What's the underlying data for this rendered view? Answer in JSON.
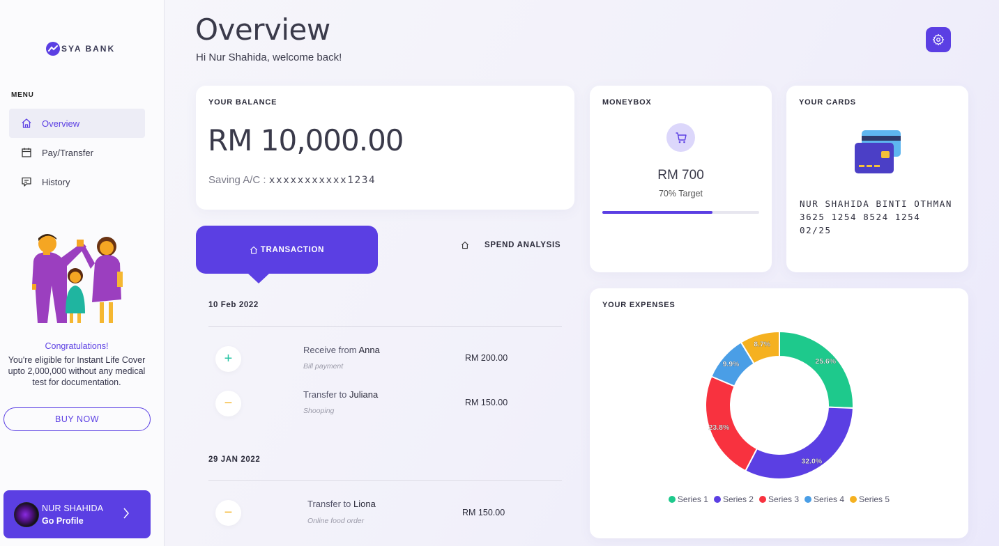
{
  "brand": {
    "name": "SYA BANK"
  },
  "sidebar": {
    "menu_title": "MENU",
    "items": [
      {
        "label": "Overview",
        "icon": "home-icon",
        "active": true
      },
      {
        "label": "Pay/Transfer",
        "icon": "calendar-icon",
        "active": false
      },
      {
        "label": "History",
        "icon": "message-icon",
        "active": false
      }
    ],
    "promo": {
      "title": "Congratulations!",
      "text": "You're eligible for Instant Life Cover upto 2,000,000 without any medical test for documentation.",
      "button": "BUY NOW"
    },
    "profile": {
      "name": "NUR SHAHIDA",
      "link": "Go Profile"
    }
  },
  "header": {
    "title": "Overview",
    "welcome": "Hi Nur Shahida, welcome back!"
  },
  "balance": {
    "label": "YOUR BALANCE",
    "amount": "RM 10,000.00",
    "account_prefix": "Saving A/C : ",
    "account_number": "xxxxxxxxxxx1234"
  },
  "moneybox": {
    "label": "MONEYBOX",
    "amount": "RM 700",
    "target": "70% Target",
    "progress": 0.7
  },
  "cards": {
    "label": "YOUR CARDS",
    "holder": "NUR SHAHIDA BINTI OTHMAN",
    "number": "3625 1254 8524 1254",
    "expiry": "02/25"
  },
  "tabs": {
    "active": "TRANSACTION",
    "inactive": "SPEND ANALYSIS"
  },
  "transactions": {
    "groups": [
      {
        "date": "10 Feb 2022",
        "items": [
          {
            "prefix": "Receive from ",
            "name": "Anna",
            "category": "Bill payment",
            "amount": "RM 200.00",
            "type": "plus"
          },
          {
            "prefix": "Transfer to ",
            "name": "Juliana",
            "category": "Shooping",
            "amount": "RM 150.00",
            "type": "minus"
          }
        ]
      },
      {
        "date": "29 JAN 2022",
        "items": [
          {
            "prefix": "Transfer to ",
            "name": "Liona",
            "category": "Online food order",
            "amount": "RM 150.00",
            "type": "minus"
          }
        ]
      }
    ]
  },
  "expenses": {
    "label": "YOUR EXPENSES"
  },
  "colors": {
    "accent": "#5b3fe3",
    "plus": "#27c4a3",
    "minus": "#f5b731"
  },
  "chart_data": {
    "type": "pie",
    "variant": "donut",
    "series": [
      {
        "name": "Series 1",
        "value": 25.6,
        "label": "25.6%",
        "color": "#1ec98c"
      },
      {
        "name": "Series 2",
        "value": 32.0,
        "label": "32.0%",
        "color": "#5b3fe3"
      },
      {
        "name": "Series 3",
        "value": 23.8,
        "label": "23.8%",
        "color": "#f8323f"
      },
      {
        "name": "Series 4",
        "value": 9.9,
        "label": "9.9%",
        "color": "#4a9ee6"
      },
      {
        "name": "Series 5",
        "value": 8.7,
        "label": "8.7%",
        "color": "#f5b120"
      }
    ],
    "legend_position": "bottom"
  }
}
